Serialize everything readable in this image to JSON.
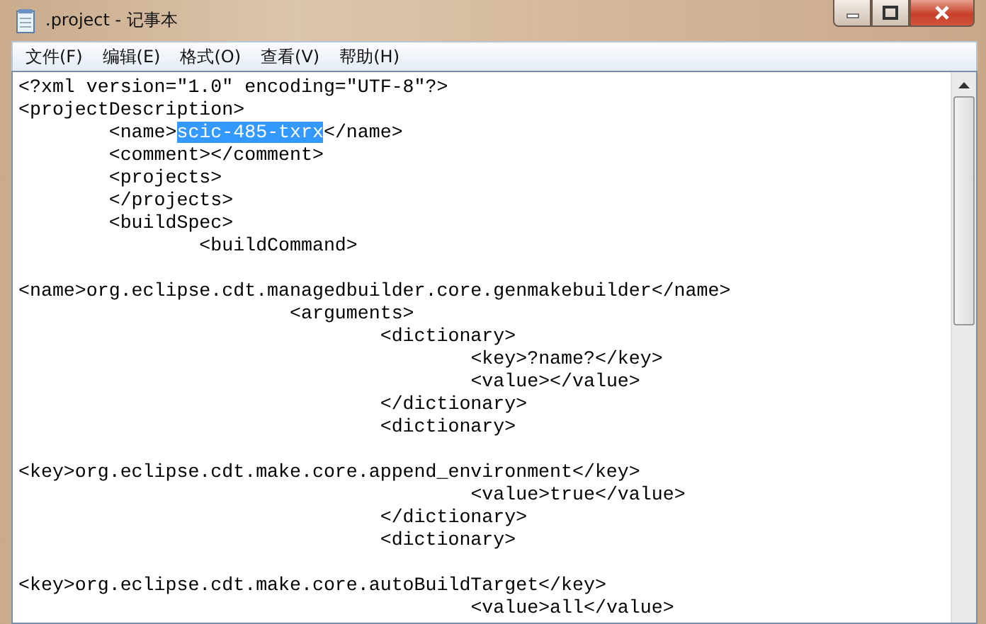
{
  "window": {
    "title": ".project - 记事本"
  },
  "menu": [
    {
      "label": "文件(F)"
    },
    {
      "label": "编辑(E)"
    },
    {
      "label": "格式(O)"
    },
    {
      "label": "查看(V)"
    },
    {
      "label": "帮助(H)"
    }
  ],
  "editor": {
    "lines": [
      {
        "kind": "text",
        "segments": [
          {
            "text": "<?xml version=\"1.0\" encoding=\"UTF-8\"?>",
            "selected": false
          }
        ]
      },
      {
        "kind": "text",
        "segments": [
          {
            "text": "<projectDescription>",
            "selected": false
          }
        ]
      },
      {
        "kind": "text",
        "segments": [
          {
            "text": "\t<name>",
            "selected": false
          },
          {
            "text": "scic-485-txrx",
            "selected": true
          },
          {
            "text": "</name>",
            "selected": false
          }
        ]
      },
      {
        "kind": "text",
        "segments": [
          {
            "text": "\t<comment></comment>",
            "selected": false
          }
        ]
      },
      {
        "kind": "text",
        "segments": [
          {
            "text": "\t<projects>",
            "selected": false
          }
        ]
      },
      {
        "kind": "text",
        "segments": [
          {
            "text": "\t</projects>",
            "selected": false
          }
        ]
      },
      {
        "kind": "text",
        "segments": [
          {
            "text": "\t<buildSpec>",
            "selected": false
          }
        ]
      },
      {
        "kind": "text",
        "segments": [
          {
            "text": "\t\t<buildCommand>",
            "selected": false
          }
        ]
      },
      {
        "kind": "blank"
      },
      {
        "kind": "text",
        "segments": [
          {
            "text": "<name>org.eclipse.cdt.managedbuilder.core.genmakebuilder</name>",
            "selected": false
          }
        ]
      },
      {
        "kind": "text",
        "segments": [
          {
            "text": "\t\t\t<arguments>",
            "selected": false
          }
        ]
      },
      {
        "kind": "text",
        "segments": [
          {
            "text": "\t\t\t\t<dictionary>",
            "selected": false
          }
        ]
      },
      {
        "kind": "text",
        "segments": [
          {
            "text": "\t\t\t\t\t<key>?name?</key>",
            "selected": false
          }
        ]
      },
      {
        "kind": "text",
        "segments": [
          {
            "text": "\t\t\t\t\t<value></value>",
            "selected": false
          }
        ]
      },
      {
        "kind": "text",
        "segments": [
          {
            "text": "\t\t\t\t</dictionary>",
            "selected": false
          }
        ]
      },
      {
        "kind": "text",
        "segments": [
          {
            "text": "\t\t\t\t<dictionary>",
            "selected": false
          }
        ]
      },
      {
        "kind": "blank"
      },
      {
        "kind": "text",
        "segments": [
          {
            "text": "<key>org.eclipse.cdt.make.core.append_environment</key>",
            "selected": false
          }
        ]
      },
      {
        "kind": "text",
        "segments": [
          {
            "text": "\t\t\t\t\t<value>true</value>",
            "selected": false
          }
        ]
      },
      {
        "kind": "text",
        "segments": [
          {
            "text": "\t\t\t\t</dictionary>",
            "selected": false
          }
        ]
      },
      {
        "kind": "text",
        "segments": [
          {
            "text": "\t\t\t\t<dictionary>",
            "selected": false
          }
        ]
      },
      {
        "kind": "blank"
      },
      {
        "kind": "text",
        "segments": [
          {
            "text": "<key>org.eclipse.cdt.make.core.autoBuildTarget</key>",
            "selected": false
          }
        ]
      },
      {
        "kind": "text",
        "segments": [
          {
            "text": "\t\t\t\t\t<value>all</value>",
            "selected": false
          }
        ]
      }
    ]
  }
}
